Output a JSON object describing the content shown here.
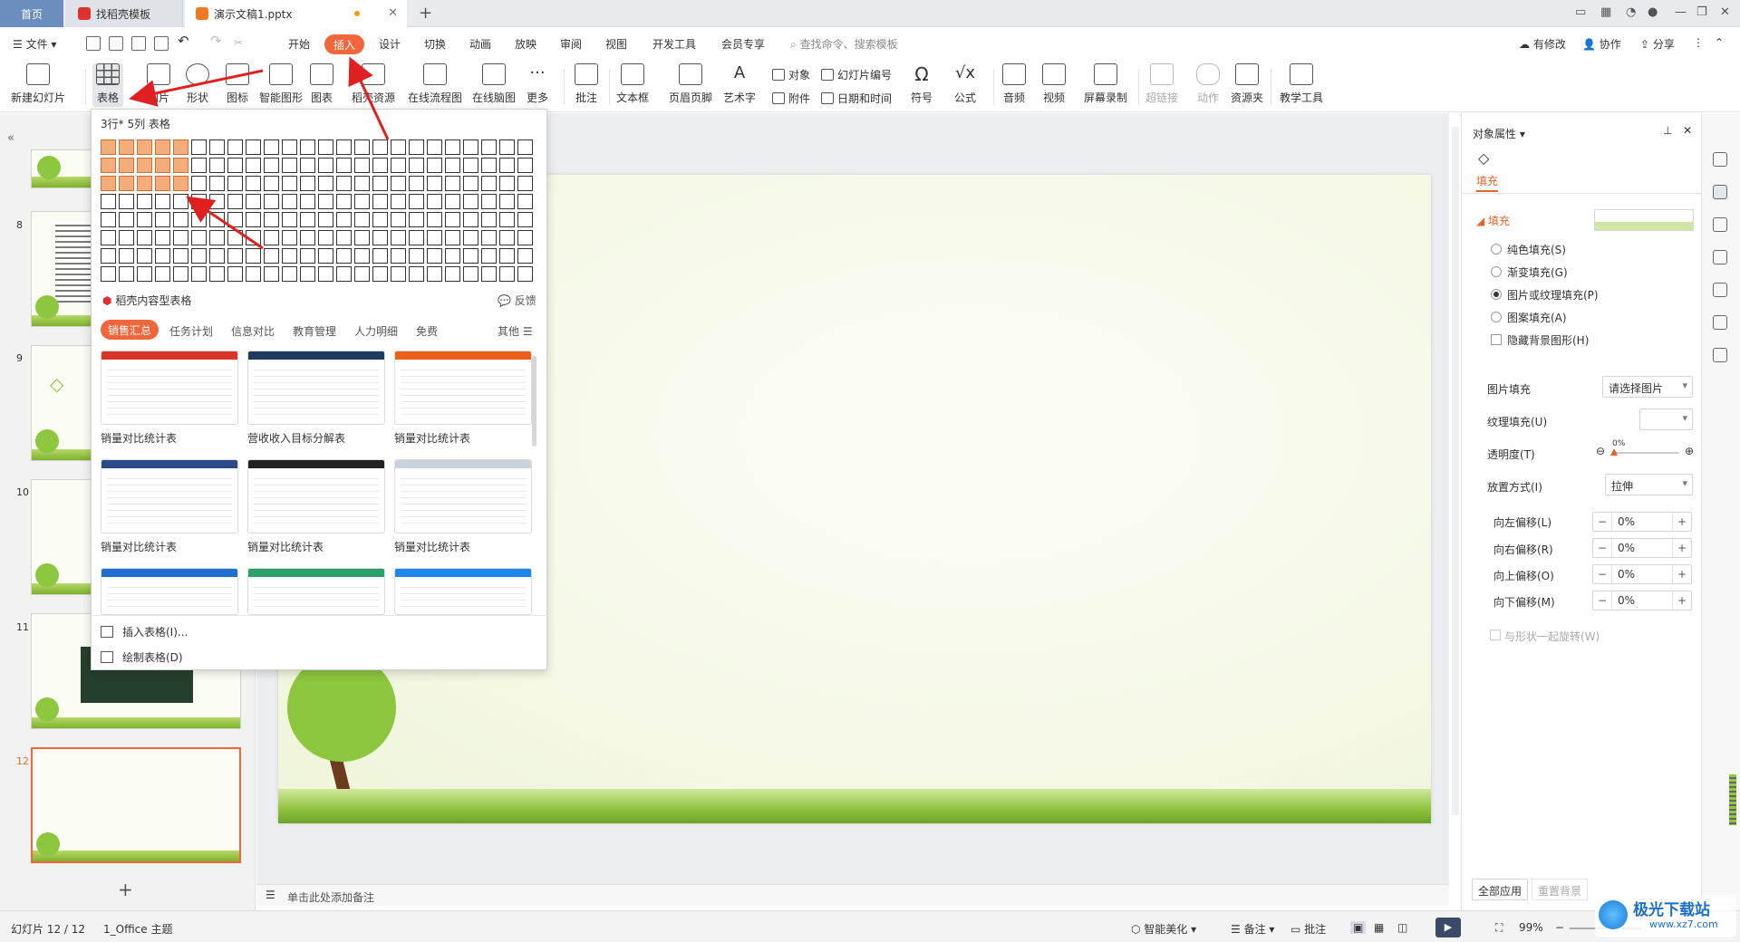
{
  "tabs": [
    {
      "label": "首页"
    },
    {
      "label": "找稻壳模板"
    },
    {
      "label": "演示文稿1.pptx"
    }
  ],
  "menu": {
    "file": "文件",
    "items": [
      "开始",
      "插入",
      "设计",
      "切换",
      "动画",
      "放映",
      "审阅",
      "视图",
      "开发工具",
      "会员专享"
    ],
    "search_placeholder": "查找命令、搜索模板",
    "right": [
      "有修改",
      "协作",
      "分享"
    ]
  },
  "ribbon": {
    "new_slide": "新建幻灯片",
    "table": "表格",
    "image": "图片",
    "shape": "形状",
    "icon": "图标",
    "smart": "智能图形",
    "chart": "图表",
    "resource": "稻壳资源",
    "flowchart": "在线流程图",
    "mindmap": "在线脑图",
    "more": "更多",
    "comment": "批注",
    "textbox": "文本框",
    "header_footer": "页眉页脚",
    "wordart": "艺术字",
    "object": "对象",
    "attach": "附件",
    "slide_no": "幻灯片编号",
    "datetime": "日期和时间",
    "symbol": "符号",
    "formula": "公式",
    "audio": "音频",
    "video": "视频",
    "screen_rec": "屏幕录制",
    "hyperlink": "超链接",
    "action": "动作",
    "resource_folder": "资源夹",
    "teaching": "教学工具"
  },
  "dropdown": {
    "header": "3行* 5列 表格",
    "grid_rows": 8,
    "grid_cols": 24,
    "selected_rows": 3,
    "selected_cols": 5,
    "section_title": "稻壳内容型表格",
    "feedback": "反馈",
    "categories": [
      "销售汇总",
      "任务计划",
      "信息对比",
      "教育管理",
      "人力明细",
      "免费"
    ],
    "other": "其他",
    "templates": [
      {
        "name": "销量对比统计表",
        "color": "#d9362b"
      },
      {
        "name": "营收收入目标分解表",
        "color": "#1f3a5f"
      },
      {
        "name": "销量对比统计表",
        "color": "#e8601c"
      },
      {
        "name": "销量对比统计表",
        "color": "#2c4a8a"
      },
      {
        "name": "销量对比统计表",
        "color": "#222222"
      },
      {
        "name": "销量对比统计表",
        "color": "#c9d3dd"
      },
      {
        "name": "",
        "color": "#1e6fcf"
      },
      {
        "name": "",
        "color": "#2aa06b"
      },
      {
        "name": "",
        "color": "#1e86e8"
      }
    ],
    "insert_table": "插入表格(I)...",
    "draw_table": "绘制表格(D)"
  },
  "slides_panel": {
    "numbers": [
      "8",
      "9",
      "10",
      "11",
      "12"
    ]
  },
  "notes_placeholder": "单击此处添加备注",
  "props": {
    "title": "对象属性",
    "tab": "填充",
    "section": "填充",
    "options": [
      "纯色填充(S)",
      "渐变填充(G)",
      "图片或纹理填充(P)",
      "图案填充(A)"
    ],
    "selected_option": 2,
    "hide_bg": "隐藏背景图形(H)",
    "picture_fill_label": "图片填充",
    "picture_fill_value": "请选择图片",
    "texture_label": "纹理填充(U)",
    "transparency_label": "透明度(T)",
    "transparency_value": "0%",
    "placement_label": "放置方式(I)",
    "placement_value": "拉伸",
    "offsets": [
      {
        "label": "向左偏移(L)",
        "value": "0%"
      },
      {
        "label": "向右偏移(R)",
        "value": "0%"
      },
      {
        "label": "向上偏移(O)",
        "value": "0%"
      },
      {
        "label": "向下偏移(M)",
        "value": "0%"
      }
    ],
    "rotate_with_shape": "与形状一起旋转(W)",
    "apply_all": "全部应用",
    "reset_bg": "重置背景"
  },
  "status": {
    "slide": "幻灯片 12 / 12",
    "theme": "1_Office 主题",
    "beautify": "智能美化",
    "notes": "备注",
    "comments": "批注",
    "zoom": "99%"
  },
  "watermark": {
    "name": "极光下载站",
    "url": "www.xz7.com"
  },
  "colors": {
    "accent": "#f2663b",
    "highlight_cell": "#f4ad7a",
    "arrow": "#e02020"
  }
}
